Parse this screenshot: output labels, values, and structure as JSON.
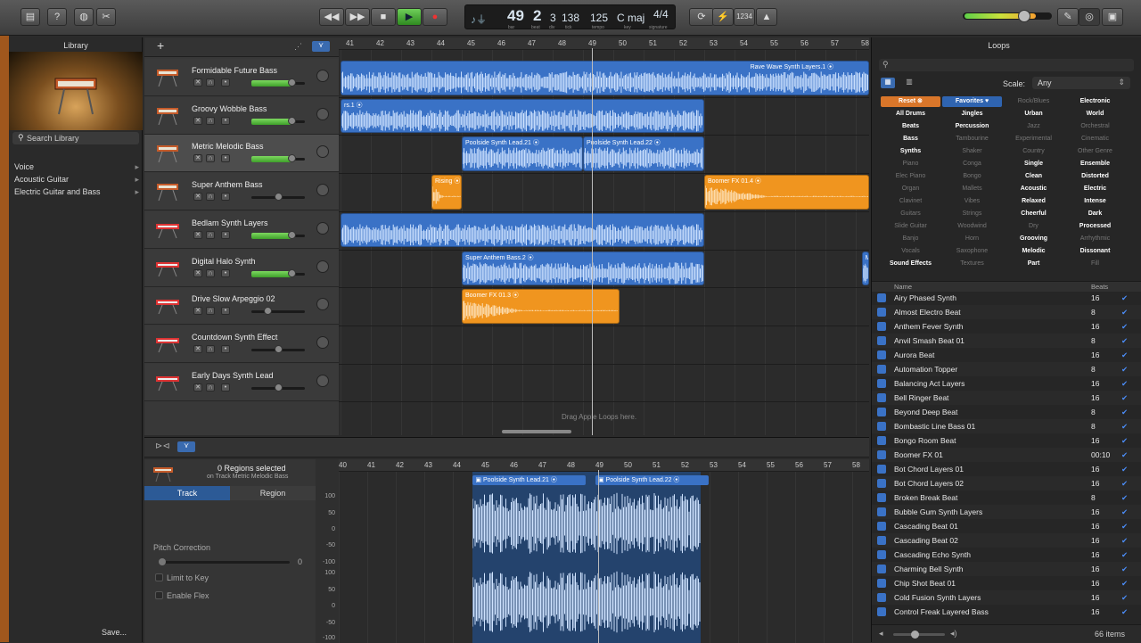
{
  "toolbar": {
    "lcd": {
      "bar": "49",
      "beat": "2",
      "div": "3",
      "tick": "138",
      "tempo": "125",
      "key": "C maj",
      "signature": "4/4",
      "sub_bar": "bar",
      "sub_beat": "beat",
      "sub_div": "div",
      "sub_tick": "tick",
      "sub_tempo": "tempo",
      "sub_key": "key",
      "sub_sig": "signature"
    },
    "count_in": "1234"
  },
  "library": {
    "title": "Library",
    "search_placeholder": "Search Library",
    "items": [
      {
        "label": "Voice"
      },
      {
        "label": "Acoustic Guitar"
      },
      {
        "label": "Electric Guitar and Bass"
      }
    ],
    "save_label": "Save..."
  },
  "tracks": [
    {
      "name": "Formidable Future Bass",
      "type": "keys",
      "level": 0.75,
      "selected": false
    },
    {
      "name": "Groovy Wobble Bass",
      "type": "keys",
      "level": 0.75,
      "selected": false
    },
    {
      "name": "Metric Melodic Bass",
      "type": "keys",
      "level": 0.75,
      "selected": true
    },
    {
      "name": "Super Anthem Bass",
      "type": "keys",
      "level": 0.5,
      "selected": false
    },
    {
      "name": "Bedlam Synth Layers",
      "type": "synth",
      "level": 0.75,
      "selected": false
    },
    {
      "name": "Digital Halo Synth",
      "type": "synth",
      "level": 0.75,
      "selected": false
    },
    {
      "name": "Drive Slow Arpeggio 02",
      "type": "synth",
      "level": 0.3,
      "selected": false
    },
    {
      "name": "Countdown Synth Effect",
      "type": "synth",
      "level": 0.5,
      "selected": false
    },
    {
      "name": "Early Days Synth Lead",
      "type": "synth",
      "level": 0.5,
      "selected": false
    }
  ],
  "ruler_bars": [
    "41",
    "42",
    "43",
    "44",
    "45",
    "46",
    "47",
    "48",
    "49",
    "50",
    "51",
    "52",
    "53",
    "54",
    "55",
    "56",
    "57",
    "58"
  ],
  "regions": [
    {
      "track": 0,
      "start": 41,
      "end": 59,
      "color": "blue",
      "label": "Rave Wave Synth Layers.1",
      "label_at": 54.4
    },
    {
      "track": 1,
      "start": 41,
      "end": 53,
      "color": "blue",
      "label": "rs.1",
      "label_at": 41
    },
    {
      "track": 2,
      "start": 45,
      "end": 49,
      "color": "blue",
      "label": "Poolside Synth Lead.21",
      "label_at": 45
    },
    {
      "track": 2,
      "start": 49,
      "end": 53,
      "color": "blue",
      "label": "Poolside Synth Lead.22",
      "label_at": 49
    },
    {
      "track": 3,
      "start": 44,
      "end": 45,
      "color": "orange",
      "label": "Rising",
      "label_at": 44
    },
    {
      "track": 3,
      "start": 53,
      "end": 59,
      "color": "orange",
      "label": "Boomer FX 01.4",
      "label_at": 53
    },
    {
      "track": 4,
      "start": 41,
      "end": 53,
      "color": "blue",
      "label": "",
      "label_at": 41
    },
    {
      "track": 5,
      "start": 45,
      "end": 53,
      "color": "blue",
      "label": "Super Anthem Bass.2",
      "label_at": 45
    },
    {
      "track": 5,
      "start": 58.2,
      "end": 59,
      "color": "blue",
      "label": "Mega Anthe",
      "label_at": 58.2
    },
    {
      "track": 6,
      "start": 45,
      "end": 50.2,
      "color": "orange",
      "label": "Boomer FX 01.3",
      "label_at": 45
    }
  ],
  "drag_hint": "Drag Apple Loops here.",
  "editor": {
    "regions_selected": "0 Regions selected",
    "on_track": "on Track Metric Melodic Bass",
    "tab_track": "Track",
    "tab_region": "Region",
    "pitch_correction_label": "Pitch Correction",
    "pitch_value": "0",
    "limit_to_key": "Limit to Key",
    "enable_flex": "Enable Flex",
    "ruler_bars": [
      "40",
      "41",
      "42",
      "43",
      "44",
      "45",
      "46",
      "47",
      "48",
      "49",
      "50",
      "51",
      "52",
      "53",
      "54",
      "55",
      "56",
      "57",
      "58"
    ],
    "db_labels": [
      "100",
      "50",
      "0",
      "-50",
      "-100",
      "100",
      "50",
      "0",
      "-50",
      "-100"
    ],
    "region1": "Poolside Synth Lead.21",
    "region2": "Poolside Synth Lead.22"
  },
  "loops": {
    "title": "Loops",
    "scale_label": "Scale:",
    "scale_value": "Any",
    "keywords": [
      [
        "Reset",
        "Favorites",
        "Rock/Blues",
        "Electronic"
      ],
      [
        "All Drums",
        "Jingles",
        "Urban",
        "World"
      ],
      [
        "Beats",
        "Percussion",
        "Jazz",
        "Orchestral"
      ],
      [
        "Bass",
        "Tambourine",
        "Experimental",
        "Cinematic"
      ],
      [
        "Synths",
        "Shaker",
        "Country",
        "Other Genre"
      ],
      [
        "Piano",
        "Conga",
        "Single",
        "Ensemble"
      ],
      [
        "Elec Piano",
        "Bongo",
        "Clean",
        "Distorted"
      ],
      [
        "Organ",
        "Mallets",
        "Acoustic",
        "Electric"
      ],
      [
        "Clavinet",
        "Vibes",
        "Relaxed",
        "Intense"
      ],
      [
        "Guitars",
        "Strings",
        "Cheerful",
        "Dark"
      ],
      [
        "Slide Guitar",
        "Woodwind",
        "Dry",
        "Processed"
      ],
      [
        "Banjo",
        "Horn",
        "Grooving",
        "Arrhythmic"
      ],
      [
        "Vocals",
        "Saxophone",
        "Melodic",
        "Dissonant"
      ],
      [
        "Sound Effects",
        "Textures",
        "Part",
        "Fill"
      ]
    ],
    "keywords_on": [
      [
        1,
        1,
        0,
        1
      ],
      [
        1,
        1,
        1,
        1
      ],
      [
        1,
        1,
        0,
        0
      ],
      [
        1,
        0,
        0,
        0
      ],
      [
        1,
        0,
        0,
        0
      ],
      [
        0,
        0,
        1,
        1
      ],
      [
        0,
        0,
        1,
        1
      ],
      [
        0,
        0,
        1,
        1
      ],
      [
        0,
        0,
        1,
        1
      ],
      [
        0,
        0,
        1,
        1
      ],
      [
        0,
        0,
        0,
        1
      ],
      [
        0,
        0,
        1,
        0
      ],
      [
        0,
        0,
        1,
        1
      ],
      [
        1,
        0,
        1,
        0
      ]
    ],
    "col_name": "Name",
    "col_beats": "Beats",
    "items": [
      {
        "name": "Airy Phased Synth",
        "beats": "16"
      },
      {
        "name": "Almost Electro Beat",
        "beats": "8"
      },
      {
        "name": "Anthem Fever Synth",
        "beats": "16"
      },
      {
        "name": "Anvil Smash Beat 01",
        "beats": "8"
      },
      {
        "name": "Aurora Beat",
        "beats": "16"
      },
      {
        "name": "Automation Topper",
        "beats": "8"
      },
      {
        "name": "Balancing Act Layers",
        "beats": "16"
      },
      {
        "name": "Bell Ringer Beat",
        "beats": "16"
      },
      {
        "name": "Beyond Deep Beat",
        "beats": "8"
      },
      {
        "name": "Bombastic Line Bass 01",
        "beats": "8"
      },
      {
        "name": "Bongo Room Beat",
        "beats": "16"
      },
      {
        "name": "Boomer FX 01",
        "beats": "00:10"
      },
      {
        "name": "Bot Chord Layers 01",
        "beats": "16"
      },
      {
        "name": "Bot Chord Layers 02",
        "beats": "16"
      },
      {
        "name": "Broken Break Beat",
        "beats": "8"
      },
      {
        "name": "Bubble Gum Synth Layers",
        "beats": "16"
      },
      {
        "name": "Cascading Beat 01",
        "beats": "16"
      },
      {
        "name": "Cascading Beat 02",
        "beats": "16"
      },
      {
        "name": "Cascading Echo Synth",
        "beats": "16"
      },
      {
        "name": "Charming Bell Synth",
        "beats": "16"
      },
      {
        "name": "Chip Shot Beat 01",
        "beats": "16"
      },
      {
        "name": "Cold Fusion Synth Layers",
        "beats": "16"
      },
      {
        "name": "Control Freak Layered Bass",
        "beats": "16"
      }
    ],
    "count": "66 items"
  },
  "colors": {
    "region_blue": "#3a72c6",
    "region_orange": "#f0951f",
    "accent_blue": "#4b8df8"
  }
}
